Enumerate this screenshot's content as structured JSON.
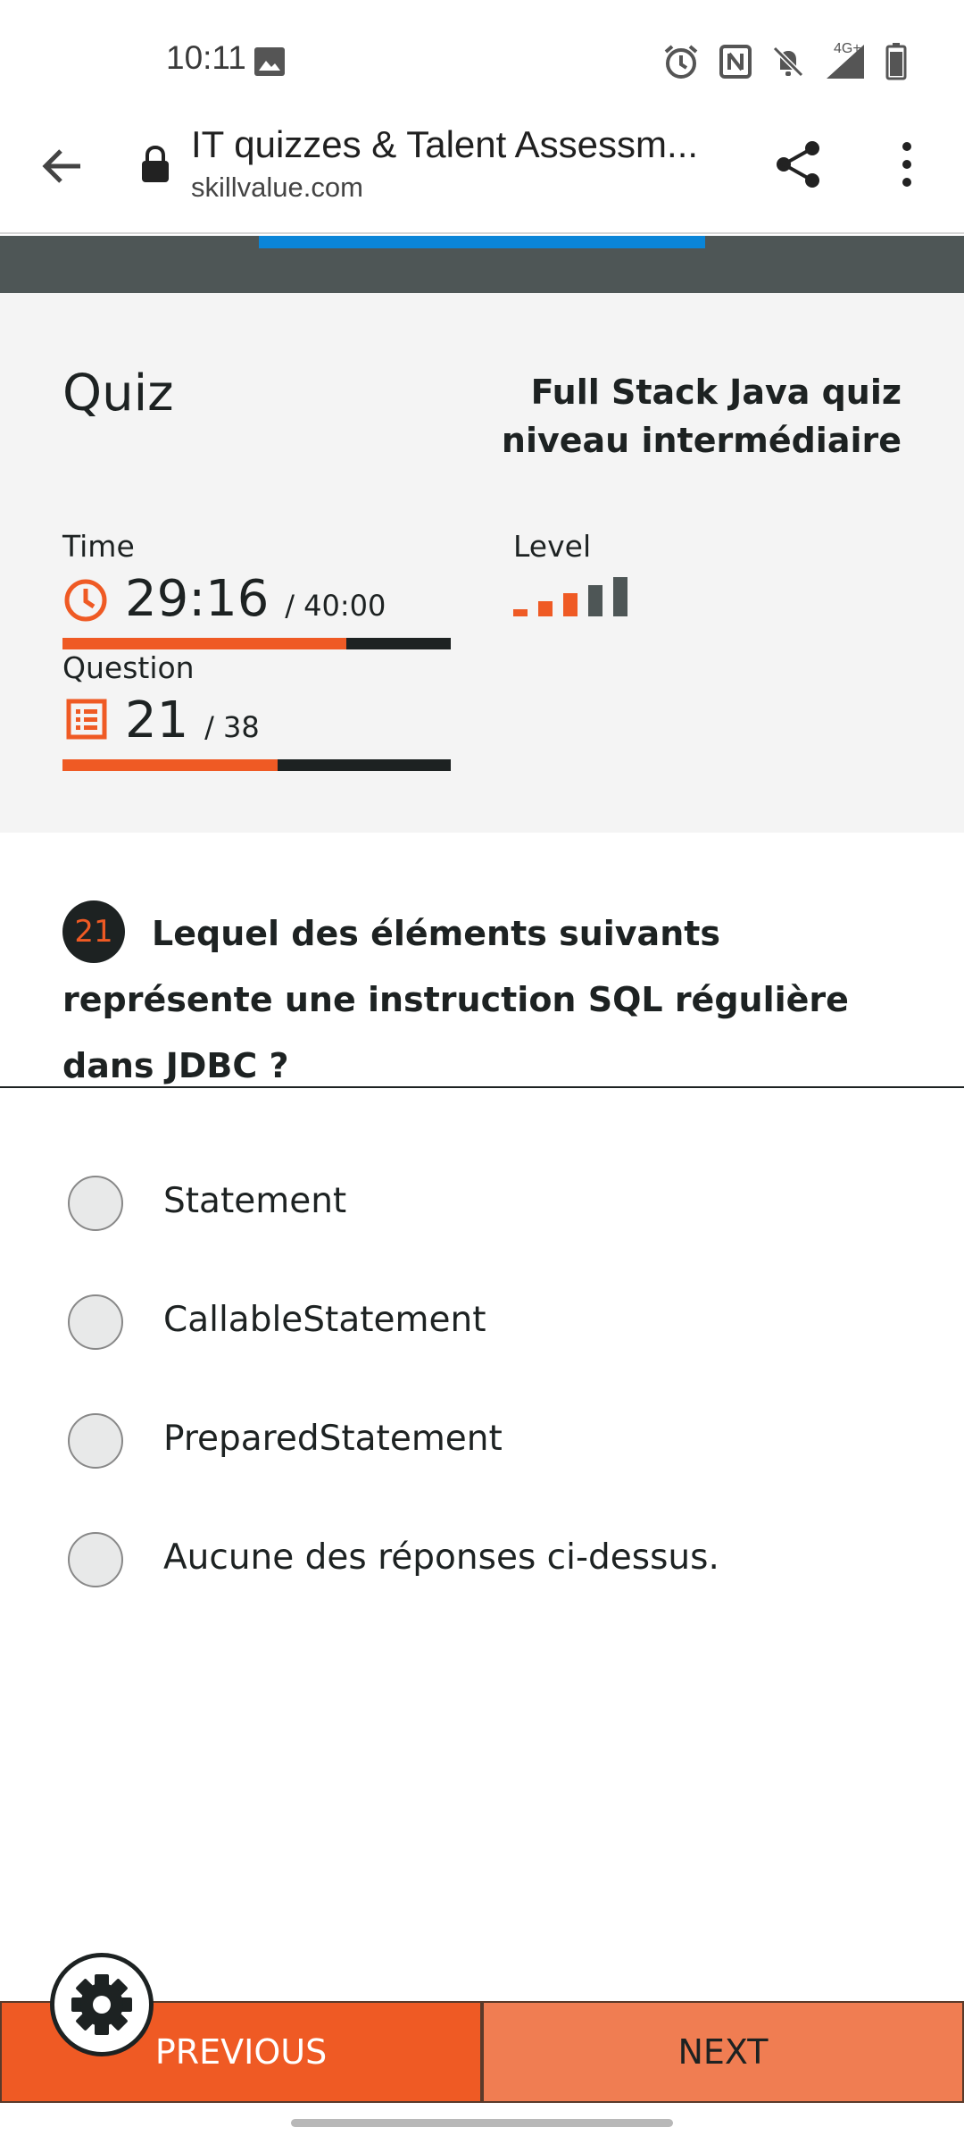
{
  "status_bar": {
    "time": "10:11",
    "network": "4G+",
    "icons": [
      "image-icon",
      "alarm-icon",
      "nfc-icon",
      "silent-icon",
      "signal-icon",
      "battery-icon"
    ]
  },
  "browser": {
    "title": "IT quizzes & Talent Assessm...",
    "url": "skillvalue.com",
    "icons": [
      "back-arrow-icon",
      "lock-icon",
      "share-icon",
      "more-vert-icon"
    ]
  },
  "quiz": {
    "heading": "Quiz",
    "name": "Full Stack Java quiz niveau intermédiaire",
    "time_label": "Time",
    "time_value": "29:16",
    "time_total": "/ 40:00",
    "time_progress": 0.73,
    "question_label": "Question",
    "question_value": "21",
    "question_total": "/ 38",
    "question_progress": 0.553,
    "level_label": "Level",
    "level_value": 3,
    "level_max": 5
  },
  "colors": {
    "accent": "#ef5a24",
    "dark": "#1d2222",
    "header_bar": "#4e5656",
    "top_progress": "#0a85d8",
    "next_button": "#f07d52"
  },
  "question": {
    "number": "21",
    "text": "Lequel des éléments suivants représente une instruction SQL régulière dans JDBC ?"
  },
  "answers": [
    {
      "label": "Statement"
    },
    {
      "label": "CallableStatement"
    },
    {
      "label": "PreparedStatement"
    },
    {
      "label": "Aucune des réponses ci-dessus."
    }
  ],
  "nav": {
    "previous_label": "PREVIOUS",
    "next_label": "NEXT"
  }
}
